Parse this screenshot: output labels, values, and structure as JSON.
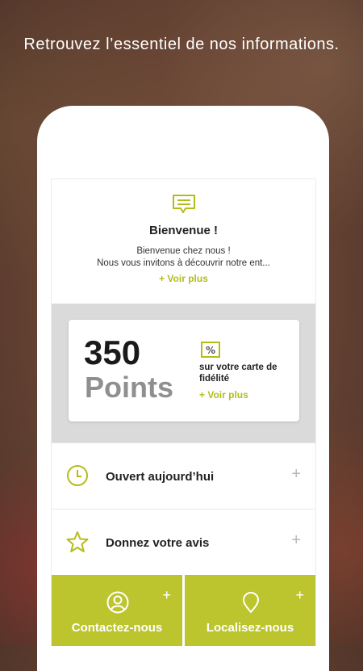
{
  "tagline": "Retrouvez l’essentiel de nos informations.",
  "welcome": {
    "icon": "message-icon",
    "title": "Bienvenue !",
    "line1": "Bienvenue chez nous !",
    "line2": "Nous vous invitons à découvrir notre ent...",
    "more": "+ Voir plus"
  },
  "points": {
    "value": "350",
    "label": "Points",
    "icon": "percent-icon",
    "description": "sur votre carte de fidélité",
    "more": "+ Voir plus"
  },
  "rows": [
    {
      "icon": "clock-icon",
      "label": "Ouvert aujourd’hui",
      "plus": "+"
    },
    {
      "icon": "star-icon",
      "label": "Donnez votre avis",
      "plus": "+"
    }
  ],
  "tiles": [
    {
      "icon": "user-icon",
      "label": "Contactez-nous",
      "plus": "+"
    },
    {
      "icon": "location-pin-icon",
      "label": "Localisez-nous",
      "plus": "+"
    }
  ],
  "colors": {
    "accent": "#b4bd18",
    "tile": "#bdc52e",
    "band": "#dadada"
  }
}
